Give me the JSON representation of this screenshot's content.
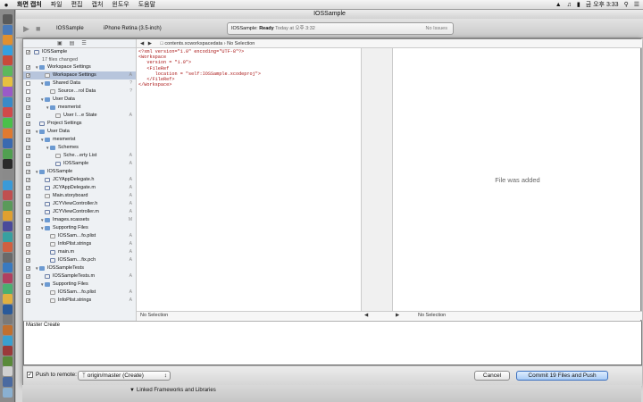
{
  "menubar": {
    "items": [
      "화면 캡처",
      "파일",
      "편집",
      "캡처",
      "윈도우",
      "도움말"
    ],
    "clock": "금 오후 3:33"
  },
  "window": {
    "title": "IOSSample"
  },
  "toolbar": {
    "scheme": "IOSSample",
    "destination": "iPhone Retina (3.5-inch)",
    "activity_app": "IOSSample:",
    "activity_status": "Ready",
    "activity_time": "Today at 오후 3:32",
    "activity_issues": "No Issues"
  },
  "sidebar": {
    "project": "IOSSample",
    "changed": "17 files changed",
    "rows": [
      {
        "label": "Workspace Settings",
        "indent": 1,
        "kind": "folder",
        "checked": true,
        "status": ""
      },
      {
        "label": "Workspace Settings",
        "indent": 2,
        "kind": "file",
        "checked": true,
        "status": "A",
        "selected": true
      },
      {
        "label": "Shared Data",
        "indent": 2,
        "kind": "folder",
        "checked": false,
        "status": "?"
      },
      {
        "label": "Source…rol Data",
        "indent": 3,
        "kind": "file",
        "checked": false,
        "status": "?"
      },
      {
        "label": "User Data",
        "indent": 2,
        "kind": "folder",
        "checked": true,
        "status": ""
      },
      {
        "label": "mesmerist",
        "indent": 3,
        "kind": "folder",
        "checked": true,
        "status": ""
      },
      {
        "label": "User I…e State",
        "indent": 4,
        "kind": "file",
        "checked": true,
        "status": "A"
      },
      {
        "label": "Project Settings",
        "indent": 1,
        "kind": "src",
        "checked": true,
        "status": ""
      },
      {
        "label": "User Data",
        "indent": 1,
        "kind": "folder",
        "checked": true,
        "status": ""
      },
      {
        "label": "mesmerist",
        "indent": 2,
        "kind": "folder",
        "checked": true,
        "status": ""
      },
      {
        "label": "Schemes",
        "indent": 3,
        "kind": "folder",
        "checked": true,
        "status": ""
      },
      {
        "label": "Sche…erty List",
        "indent": 4,
        "kind": "file",
        "checked": true,
        "status": "A"
      },
      {
        "label": "IOSSample",
        "indent": 4,
        "kind": "src",
        "checked": true,
        "status": "A"
      },
      {
        "label": "IOSSample",
        "indent": 1,
        "kind": "folder",
        "checked": true,
        "status": ""
      },
      {
        "label": "JCYAppDelegate.h",
        "indent": 2,
        "kind": "src",
        "checked": true,
        "status": "A"
      },
      {
        "label": "JCYAppDelegate.m",
        "indent": 2,
        "kind": "src",
        "checked": true,
        "status": "A"
      },
      {
        "label": "Main.storyboard",
        "indent": 2,
        "kind": "file",
        "checked": true,
        "status": "A"
      },
      {
        "label": "JCYViewController.h",
        "indent": 2,
        "kind": "src",
        "checked": true,
        "status": "A"
      },
      {
        "label": "JCYViewController.m",
        "indent": 2,
        "kind": "src",
        "checked": true,
        "status": "A"
      },
      {
        "label": "Images.xcassets",
        "indent": 2,
        "kind": "folder",
        "checked": true,
        "status": "M"
      },
      {
        "label": "Supporting Files",
        "indent": 2,
        "kind": "folder",
        "checked": true,
        "status": ""
      },
      {
        "label": "IOSSam…fo.plist",
        "indent": 3,
        "kind": "file",
        "checked": true,
        "status": "A"
      },
      {
        "label": "InfoPlist.strings",
        "indent": 3,
        "kind": "file",
        "checked": true,
        "status": "A"
      },
      {
        "label": "main.m",
        "indent": 3,
        "kind": "src",
        "checked": true,
        "status": "A"
      },
      {
        "label": "IOSSam…fix.pch",
        "indent": 3,
        "kind": "src",
        "checked": true,
        "status": "A"
      },
      {
        "label": "IOSSampleTests",
        "indent": 1,
        "kind": "folder",
        "checked": true,
        "status": ""
      },
      {
        "label": "IOSSampleTests.m",
        "indent": 2,
        "kind": "src",
        "checked": true,
        "status": "A"
      },
      {
        "label": "Supporting Files",
        "indent": 2,
        "kind": "folder",
        "checked": true,
        "status": ""
      },
      {
        "label": "IOSSam…fo.plist",
        "indent": 3,
        "kind": "file",
        "checked": true,
        "status": "A"
      },
      {
        "label": "InfoPlist.strings",
        "indent": 3,
        "kind": "file",
        "checked": true,
        "status": "A"
      }
    ]
  },
  "editor": {
    "path": "contents.xcworkspacedata",
    "selection": "No Selection",
    "code": [
      "<?xml version=\"1.0\" encoding=\"UTF-8\"?>",
      "<Workspace",
      "   version = \"1.0\">",
      "   <FileRef",
      "      location = \"self:IOSSample.xcodeproj\">",
      "   </FileRef>",
      "</Workspace>"
    ],
    "right_message": "File was added",
    "bottom_left": "No Selection",
    "bottom_right": "No Selection"
  },
  "commit": {
    "message": "Master Create"
  },
  "footer": {
    "push_label": "Push to remote:",
    "push_checked": true,
    "remote": "origin/master (Create)",
    "cancel_label": "Cancel",
    "commit_label": "Commit 19 Files and Push"
  },
  "statusbar": {
    "item": "Linked Frameworks and Libraries"
  }
}
